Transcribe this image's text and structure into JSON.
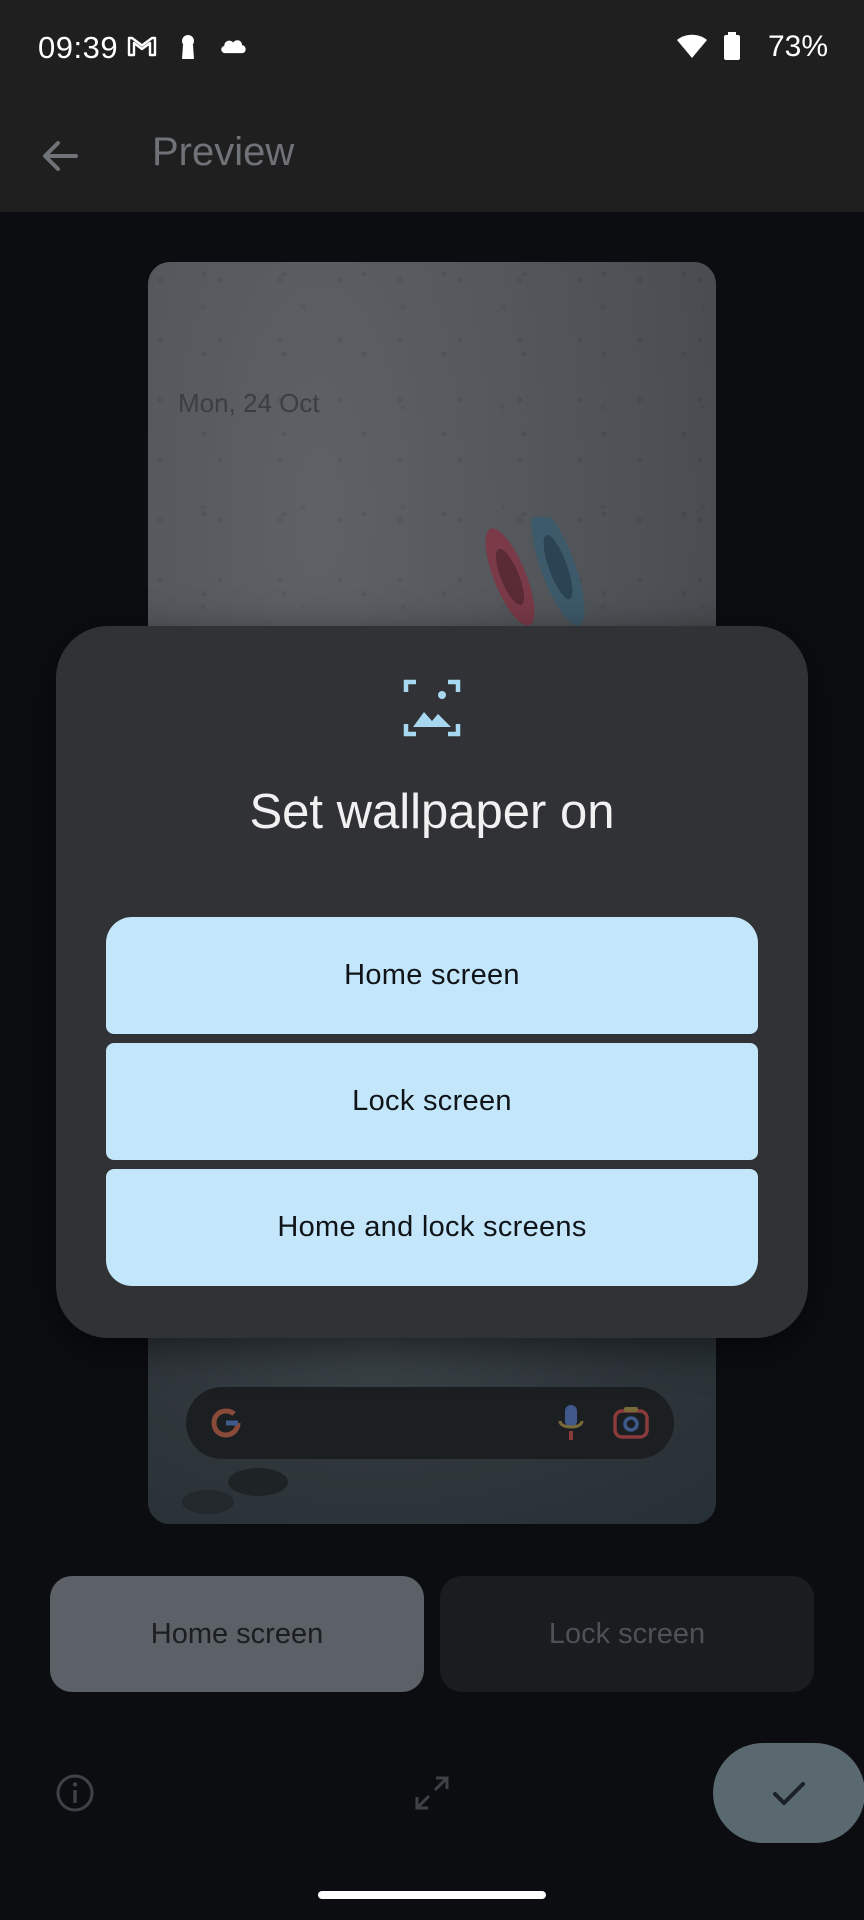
{
  "status_bar": {
    "time": "09:39",
    "battery_percent": "73%",
    "icons": [
      "gmail-icon",
      "keyhole-icon",
      "cloud-icon",
      "wifi-icon",
      "battery-icon"
    ]
  },
  "app_bar": {
    "title": "Preview",
    "back_icon": "arrow-back-icon"
  },
  "preview": {
    "date": "Mon, 24 Oct",
    "search_bar_icons": [
      "google-g-icon",
      "mic-icon",
      "lens-camera-icon"
    ]
  },
  "dialog": {
    "icon": "wallpaper-icon",
    "title": "Set wallpaper on",
    "options": [
      {
        "label": "Home screen"
      },
      {
        "label": "Lock screen"
      },
      {
        "label": "Home and lock screens"
      }
    ]
  },
  "tabs": {
    "home_label": "Home screen",
    "lock_label": "Lock screen",
    "selected": "Home screen"
  },
  "bottom_actions": {
    "info_icon": "info-icon",
    "expand_icon": "fullscreen-icon",
    "apply_icon": "check-icon"
  },
  "colors": {
    "option_button": "#c3e6fb",
    "dialog_bg": "#313235",
    "accent_icon": "#a8d8f0"
  }
}
